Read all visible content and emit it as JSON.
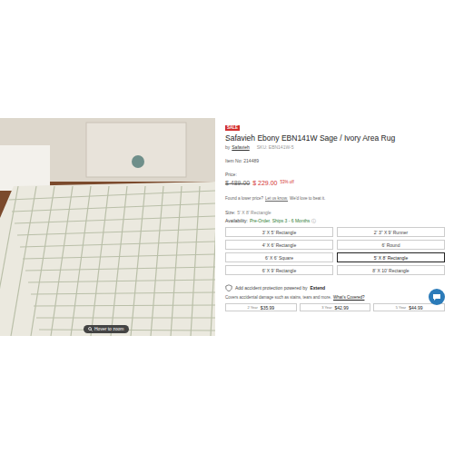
{
  "product": {
    "badge": "SALE",
    "title": "Safavieh Ebony EBN141W Sage / Ivory Area Rug",
    "by_label": "by",
    "brand": "Safavieh",
    "sku": "SKU: EBN141W-5",
    "item_no": "Item No: 214489",
    "price_label": "Price:",
    "old_price": "$ 489.00",
    "new_price": "$ 229.00",
    "discount": "53% off",
    "price_match": {
      "text": "Found a lower price?",
      "link": "Let us know.",
      "tail": "We'd love to beat it."
    }
  },
  "photo": {
    "zoom_hint": "Hover to zoom"
  },
  "size": {
    "label": "Size:",
    "value": "5' X 8' Rectangle"
  },
  "availability": {
    "label": "Availability:",
    "value": "Pre-Order. Ships 3 - 6 Months",
    "info_icon": "ⓘ"
  },
  "sizes": [
    {
      "label": "3' X 5' Rectangle",
      "selected": false
    },
    {
      "label": "2' 3\" X 9' Runner",
      "selected": false
    },
    {
      "label": "4' X 6' Rectangle",
      "selected": false
    },
    {
      "label": "6' Round",
      "selected": false
    },
    {
      "label": "6' X 6' Square",
      "selected": false
    },
    {
      "label": "5' X 8' Rectangle",
      "selected": true
    },
    {
      "label": "6' X 9' Rectangle",
      "selected": false
    },
    {
      "label": "8' X 10' Rectangle",
      "selected": false
    }
  ],
  "protection": {
    "text": "Add accident protection powered by",
    "brand": "Extend",
    "covers": "Covers accidental damage such as stains, tears and more.",
    "link": "What's Covered?"
  },
  "plans": [
    {
      "term": "2 Year",
      "price": "$35.99"
    },
    {
      "term": "3 Year",
      "price": "$42.99"
    },
    {
      "term": "5 Year",
      "price": "$44.99"
    }
  ]
}
